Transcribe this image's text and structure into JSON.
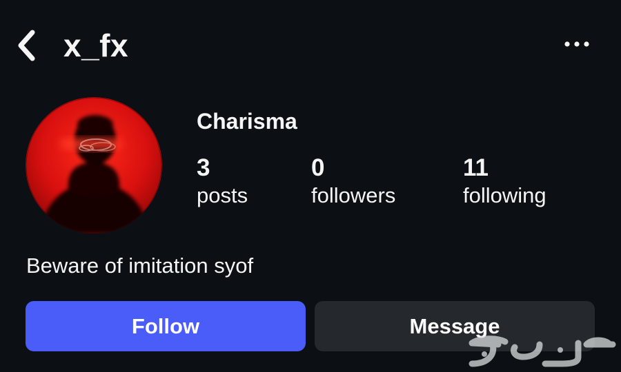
{
  "header": {
    "username": "x_fx",
    "back_icon": "chevron-left-icon",
    "more_icon": "more-horizontal-icon"
  },
  "profile": {
    "display_name": "Charisma",
    "avatar_icon": "avatar-photo",
    "stats": {
      "posts": {
        "count": "3",
        "label": "posts"
      },
      "followers": {
        "count": "0",
        "label": "followers"
      },
      "following": {
        "count": "11",
        "label": "following"
      }
    },
    "bio": "Beware of imitation syof"
  },
  "actions": {
    "follow_label": "Follow",
    "message_label": "Message"
  },
  "colors": {
    "background": "#0c1014",
    "text": "#f5f5f5",
    "follow_button": "#4a5df9",
    "message_button": "#25292e",
    "avatar_red": "#d8100f"
  },
  "watermark": {
    "logo_text": "حراج"
  }
}
